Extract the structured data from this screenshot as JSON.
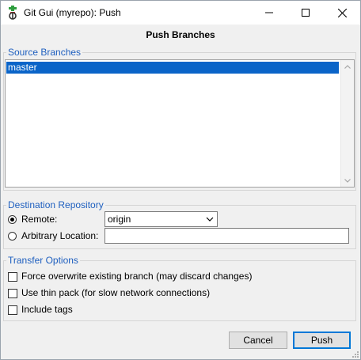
{
  "window": {
    "title": "Git Gui (myrepo): Push"
  },
  "heading": "Push Branches",
  "source": {
    "legend": "Source Branches",
    "branches": [
      "master"
    ]
  },
  "destination": {
    "legend": "Destination Repository",
    "remote_label": "Remote:",
    "remote_value": "origin",
    "arbitrary_label": "Arbitrary Location:",
    "arbitrary_value": ""
  },
  "transfer": {
    "legend": "Transfer Options",
    "force_label": "Force overwrite existing branch (may discard changes)",
    "thin_label": "Use thin pack (for slow network connections)",
    "tags_label": "Include tags"
  },
  "buttons": {
    "cancel": "Cancel",
    "push": "Push"
  },
  "colors": {
    "selection": "#0a64c8",
    "legend": "#1e5fbf",
    "default_button_border": "#0078d7"
  },
  "icons": [
    "git-gui-icon",
    "minimize-icon",
    "maximize-icon",
    "close-icon",
    "scroll-up-icon",
    "scroll-down-icon",
    "dropdown-chevron-icon",
    "resize-grip-icon"
  ]
}
